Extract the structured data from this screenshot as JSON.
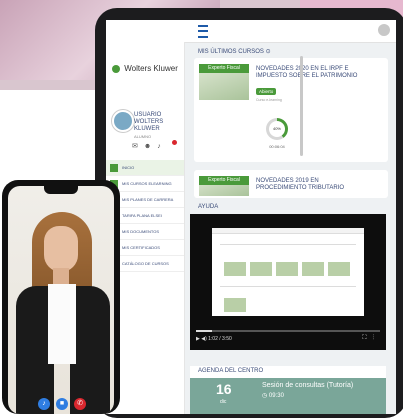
{
  "sidebar": {
    "brand": "Wolters Kluwer",
    "user_name": "USUARIO WOLTERS KLUWER",
    "user_role": "ALUMNO",
    "menu": [
      {
        "label": "INICIO",
        "active": true
      },
      {
        "label": "MIS CURSOS ELEARNING",
        "active": false
      },
      {
        "label": "MIS PLANES DE CARRERA",
        "active": false
      },
      {
        "label": "TARIFA PLANA ELSEI",
        "active": false
      },
      {
        "label": "MIS DOCUMENTOS",
        "active": false
      },
      {
        "label": "MIS CERTIFICADOS",
        "active": false
      },
      {
        "label": "CATÁLOGO DE CURSOS",
        "active": false
      }
    ]
  },
  "courses": {
    "title": "MIS ÚLTIMOS CURSOS",
    "items": [
      {
        "tag": "Experto Fiscal",
        "title": "NOVEDADES 2020 EN EL IRPF E IMPUESTO SOBRE EL PATRIMONIO",
        "status": "Abierto",
        "subtitle": "Curso e-learning",
        "progress_percent": 40,
        "progress_label": "40%",
        "time": "00:06:04"
      },
      {
        "tag": "Experto Fiscal",
        "title": "NOVEDADES 2019 EN PROCEDIMIENTO TRIBUTARIO"
      }
    ]
  },
  "help": {
    "title": "AYUDA",
    "video_time": "1:02 / 3:50"
  },
  "agenda": {
    "title": "AGENDA DEL CENTRO",
    "day": "16",
    "month": "dic",
    "event": "Sesión de consultas (Tutoría)",
    "time": "09:30"
  },
  "colors": {
    "accent_green": "#4a9a3a",
    "text_blue": "#3a4b78",
    "agenda_teal": "#7aa699",
    "call_end": "#d9272e",
    "call_btn": "#2f7de1"
  }
}
